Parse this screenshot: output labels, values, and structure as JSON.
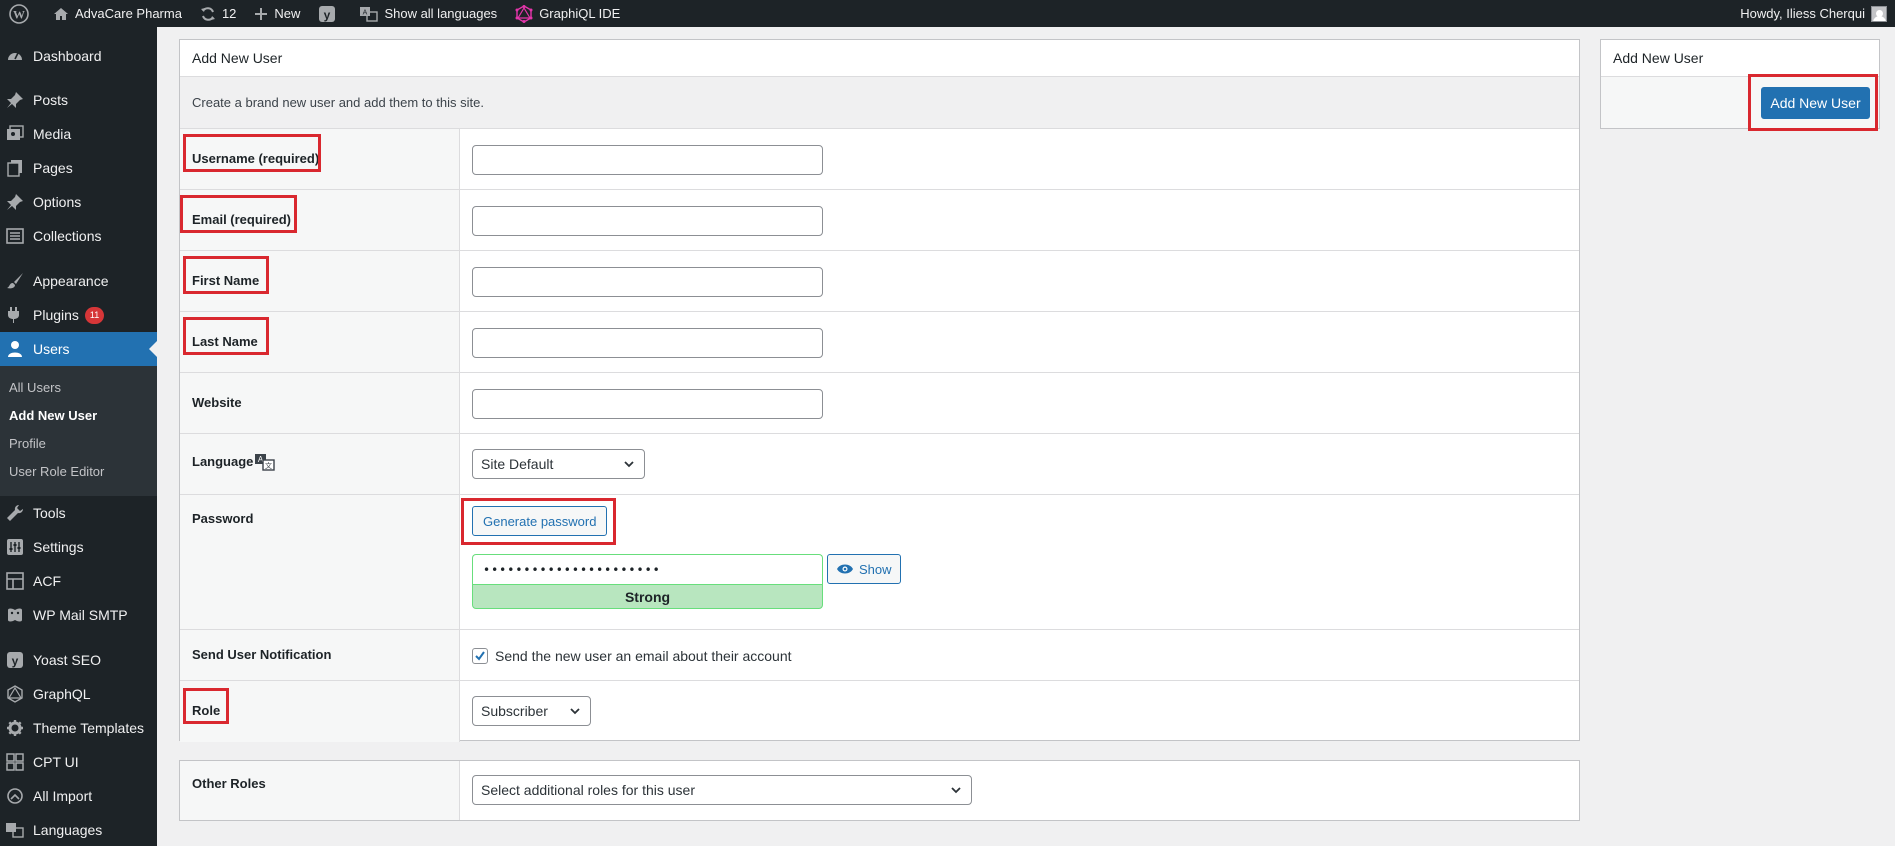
{
  "adminbar": {
    "site_name": "AdvaCare Pharma",
    "updates_count": "12",
    "new_label": "New",
    "languages_label": "Show all languages",
    "graphiql_label": "GraphiQL IDE",
    "howdy": "Howdy, Iliess Cherqui"
  },
  "sidebar": {
    "dashboard": "Dashboard",
    "posts": "Posts",
    "media": "Media",
    "pages": "Pages",
    "options": "Options",
    "collections": "Collections",
    "appearance": "Appearance",
    "plugins": "Plugins",
    "plugins_badge": "11",
    "users": "Users",
    "sub_all_users": "All Users",
    "sub_add_new_user": "Add New User",
    "sub_profile": "Profile",
    "sub_role_editor": "User Role Editor",
    "tools": "Tools",
    "settings": "Settings",
    "acf": "ACF",
    "wp_mail_smtp": "WP Mail SMTP",
    "yoast": "Yoast SEO",
    "graphql": "GraphQL",
    "theme_templates": "Theme Templates",
    "cpt_ui": "CPT UI",
    "all_import": "All Import",
    "languages": "Languages"
  },
  "form": {
    "title": "Add New User",
    "description": "Create a brand new user and add them to this site.",
    "username_label": "Username (required)",
    "email_label": "Email (required)",
    "first_name_label": "First Name",
    "last_name_label": "Last Name",
    "website_label": "Website",
    "language_label": "Language",
    "language_value": "Site Default",
    "password_label": "Password",
    "generate_password": "Generate password",
    "password_value": "••••••••••••••••••••••",
    "show_label": "Show",
    "strength": "Strong",
    "notification_label": "Send User Notification",
    "notification_text": "Send the new user an email about their account",
    "notification_checked": true,
    "role_label": "Role",
    "role_value": "Subscriber",
    "other_roles_label": "Other Roles",
    "other_roles_placeholder": "Select additional roles for this user"
  },
  "sidebox": {
    "title": "Add New User",
    "button": "Add New User"
  },
  "colors": {
    "admin_dark": "#1d2327",
    "accent_blue": "#2271b1",
    "highlight_red": "#d9282f",
    "strength_green": "#b8e6bf"
  }
}
